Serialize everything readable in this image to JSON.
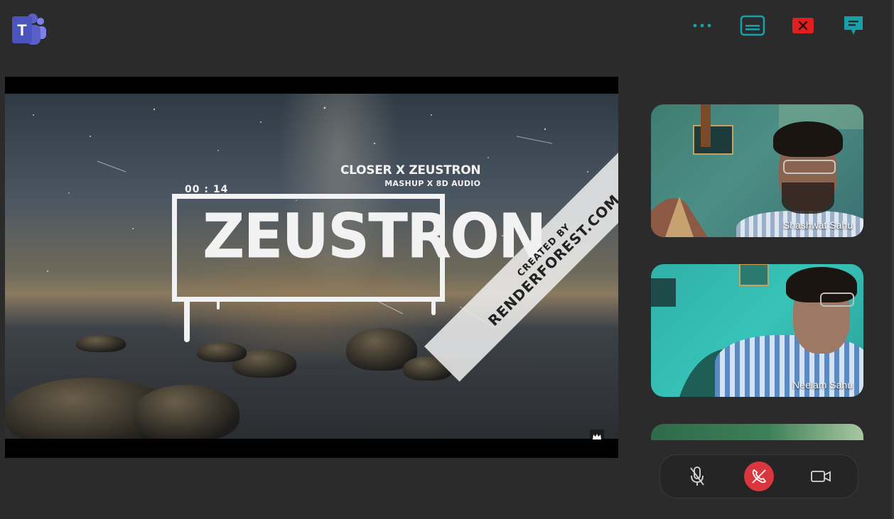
{
  "app": {
    "logo_icon": "microsoft-teams-logo"
  },
  "top_actions": [
    {
      "id": "more",
      "icon": "more-options-icon"
    },
    {
      "id": "captions",
      "icon": "captions-icon"
    },
    {
      "id": "close",
      "icon": "close-icon"
    },
    {
      "id": "chat",
      "icon": "chat-icon"
    }
  ],
  "shared_video": {
    "timecode": "00 : 14",
    "title_line1": "CLOSER X ZEUSTRON",
    "title_line2": "MASHUP X 8D AUDIO",
    "brand_word": "ZEUSTRON",
    "ribbon_line1": "CREATED BY",
    "ribbon_line2": "RENDERFOREST.COM"
  },
  "participants": [
    {
      "name": "Shashwat Sahu"
    },
    {
      "name": "Neelam Sahu"
    },
    {
      "name": ""
    }
  ],
  "call_controls": [
    {
      "id": "mute",
      "icon": "microphone-off-icon"
    },
    {
      "id": "hangup",
      "icon": "hang-up-icon"
    },
    {
      "id": "camera",
      "icon": "camera-icon"
    }
  ],
  "colors": {
    "background": "#2b2b2b",
    "accent_teal": "#18a0a8",
    "close_red": "#e02020",
    "hangup_red": "#d9363e",
    "teams_purple": "#5b5fc7"
  }
}
